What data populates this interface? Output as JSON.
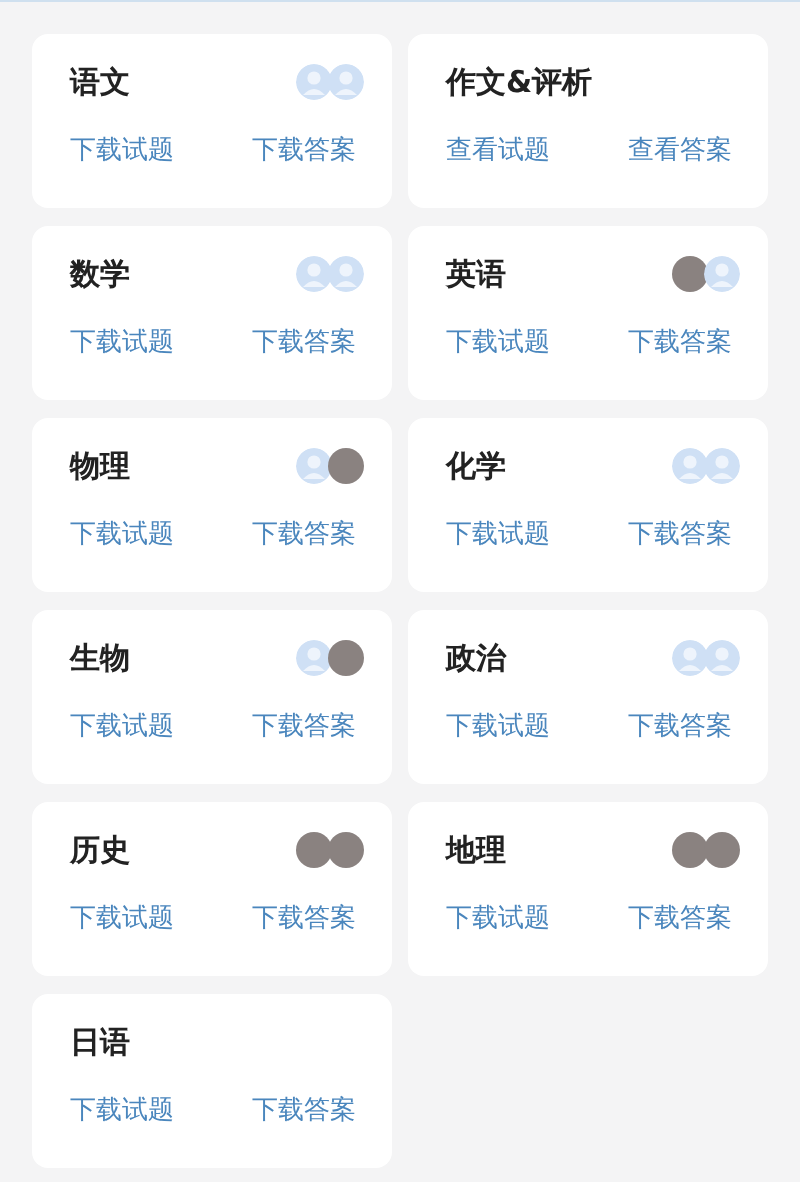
{
  "subjects": [
    {
      "title": "语文",
      "avatars": [
        {
          "kind": "placeholder"
        },
        {
          "kind": "placeholder"
        }
      ],
      "links": [
        "下载试题",
        "下载答案"
      ]
    },
    {
      "title": "作文&评析",
      "links": [
        "查看试题",
        "查看答案"
      ]
    },
    {
      "title": "数学",
      "avatars": [
        {
          "kind": "placeholder"
        },
        {
          "kind": "placeholder"
        }
      ],
      "links": [
        "下载试题",
        "下载答案"
      ]
    },
    {
      "title": "英语",
      "avatars": [
        {
          "kind": "photo"
        },
        {
          "kind": "placeholder"
        }
      ],
      "links": [
        "下载试题",
        "下载答案"
      ]
    },
    {
      "title": "物理",
      "avatars": [
        {
          "kind": "placeholder"
        },
        {
          "kind": "photo"
        }
      ],
      "links": [
        "下载试题",
        "下载答案"
      ]
    },
    {
      "title": "化学",
      "avatars": [
        {
          "kind": "placeholder"
        },
        {
          "kind": "placeholder"
        }
      ],
      "links": [
        "下载试题",
        "下载答案"
      ]
    },
    {
      "title": "生物",
      "avatars": [
        {
          "kind": "placeholder"
        },
        {
          "kind": "photo"
        }
      ],
      "links": [
        "下载试题",
        "下载答案"
      ]
    },
    {
      "title": "政治",
      "avatars": [
        {
          "kind": "placeholder"
        },
        {
          "kind": "placeholder"
        }
      ],
      "links": [
        "下载试题",
        "下载答案"
      ]
    },
    {
      "title": "历史",
      "avatars": [
        {
          "kind": "photo"
        },
        {
          "kind": "photo"
        }
      ],
      "links": [
        "下载试题",
        "下载答案"
      ]
    },
    {
      "title": "地理",
      "avatars": [
        {
          "kind": "photo"
        },
        {
          "kind": "photo"
        }
      ],
      "links": [
        "下载试题",
        "下载答案"
      ]
    },
    {
      "title": "日语",
      "links": [
        "下载试题",
        "下载答案"
      ]
    }
  ]
}
